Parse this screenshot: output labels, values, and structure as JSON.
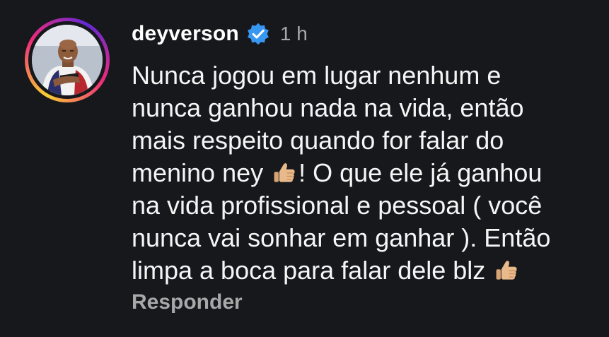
{
  "comment": {
    "username": "deyverson",
    "verified_icon": "verified-badge-icon",
    "time_ago": "1 h",
    "lines": [
      "Nunca jogou em lugar nenhum e",
      "nunca ganhou nada na vida, então",
      "mais respeito quando for falar do",
      {
        "before": "menino ney ",
        "after": "! O que ele já ganhou"
      },
      "na vida profissional e pessoal ( você",
      "nunca vai sonhar em ganhar ). Então",
      {
        "before": "limpa a boca para falar dele blz ",
        "after": ""
      }
    ],
    "emoji_icon": "thumbs-up-emoji",
    "reply_label": "Responder"
  },
  "colors": {
    "background": "#16181c",
    "text": "#f5f5f5",
    "muted": "#a8a8a8",
    "verified": "#3897f0",
    "thumb": "#e8b98a"
  }
}
